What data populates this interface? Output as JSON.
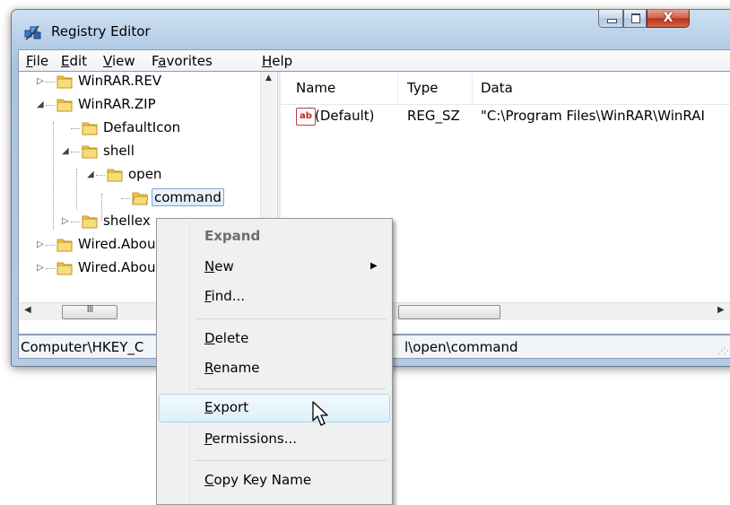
{
  "window": {
    "title": "Registry Editor",
    "close_glyph": "X"
  },
  "menubar": [
    {
      "pre": "",
      "key": "F",
      "post": "ile"
    },
    {
      "pre": "",
      "key": "E",
      "post": "dit"
    },
    {
      "pre": "",
      "key": "V",
      "post": "iew"
    },
    {
      "pre": "F",
      "key": "a",
      "post": "vorites"
    },
    {
      "pre": "",
      "key": "H",
      "post": "elp"
    }
  ],
  "tree": {
    "items": [
      {
        "label": "WinRAR.REV",
        "expander": "▷"
      },
      {
        "label": "WinRAR.ZIP",
        "expander": "◢"
      },
      {
        "label": "DefaultIcon",
        "expander": ""
      },
      {
        "label": "shell",
        "expander": "◢"
      },
      {
        "label": "open",
        "expander": "◢"
      },
      {
        "label": "command",
        "expander": "",
        "selected": true
      },
      {
        "label": "shellex",
        "expander": "▷"
      },
      {
        "label": "Wired.Abou",
        "expander": "▷"
      },
      {
        "label": "Wired.Abou",
        "expander": "▷"
      }
    ],
    "scroll_up_glyph": "▲",
    "scroll_left_glyph": "◀",
    "scroll_right_glyph": "▶",
    "scroll_grip": "III"
  },
  "list": {
    "columns": [
      "Name",
      "Type",
      "Data"
    ],
    "rows": [
      {
        "icon": "string-value-icon",
        "icon_text": "ab",
        "name": "(Default)",
        "type": "REG_SZ",
        "data": "\"C:\\Program Files\\WinRAR\\WinRAI"
      }
    ]
  },
  "status": {
    "path_start": "Computer\\HKEY_C",
    "path_end": "l\\open\\command"
  },
  "context_menu": {
    "items": [
      {
        "pre": "",
        "key": "",
        "post": "Expand",
        "bold": true
      },
      {
        "pre": "",
        "key": "N",
        "post": "ew",
        "submenu": true,
        "arrow": "▶"
      },
      {
        "pre": "",
        "key": "F",
        "post": "ind..."
      },
      {
        "pre": "",
        "key": "D",
        "post": "elete"
      },
      {
        "pre": "",
        "key": "R",
        "post": "ename"
      },
      {
        "pre": "",
        "key": "E",
        "post": "xport",
        "hover": true
      },
      {
        "pre": "",
        "key": "P",
        "post": "ermissions..."
      },
      {
        "pre": "",
        "key": "C",
        "post": "opy Key Name"
      }
    ]
  },
  "colors": {
    "window_frame": "#b9d1ea",
    "close_button": "#c8442b",
    "selection": "#dceafa",
    "menu_hover": "#dcf0fb",
    "folder": "#f1c84a"
  }
}
